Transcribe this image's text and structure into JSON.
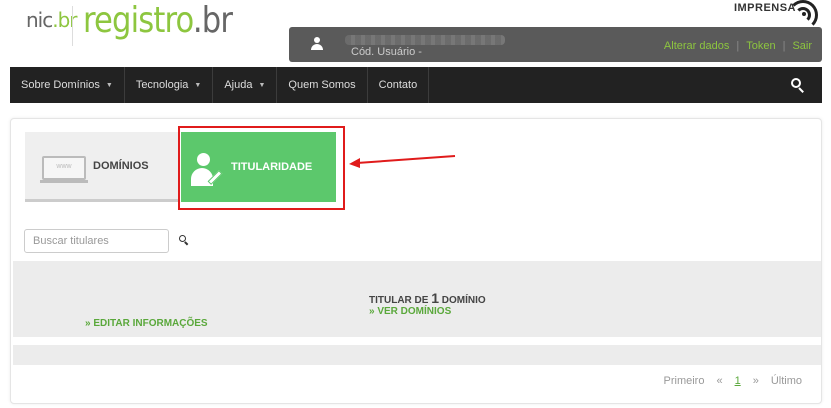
{
  "brand": {
    "nic": "nic",
    "nic_suffix": ".br",
    "registro": "registro",
    "registro_suffix": ".br"
  },
  "imprensa": "IMPRENSA",
  "user": {
    "code_label": "Cód. Usuário -",
    "links": [
      "Alterar dados",
      "Token",
      "Sair"
    ]
  },
  "nav": {
    "items": [
      "Sobre Domínios",
      "Tecnologia",
      "Ajuda",
      "Quem Somos",
      "Contato"
    ]
  },
  "tabs": {
    "dominios": "DOMÍNIOS",
    "titularidade": "TITULARIDADE"
  },
  "search": {
    "placeholder": "Buscar titulares"
  },
  "result": {
    "edit": "» EDITAR INFORMAÇÕES",
    "titular_prefix": "TITULAR DE ",
    "count": "1",
    "titular_suffix": " DOMÍNIO",
    "ver": "» VER DOMÍNIOS"
  },
  "pagination": {
    "first": "Primeiro",
    "prev": "«",
    "current": "1",
    "next": "»",
    "last": "Último"
  },
  "colors": {
    "accent": "#8dc63f",
    "tab_active": "#5cc86c",
    "highlight": "#e01b1b",
    "nav_bg": "#222222"
  },
  "icons": {
    "monitor_text": "www"
  }
}
